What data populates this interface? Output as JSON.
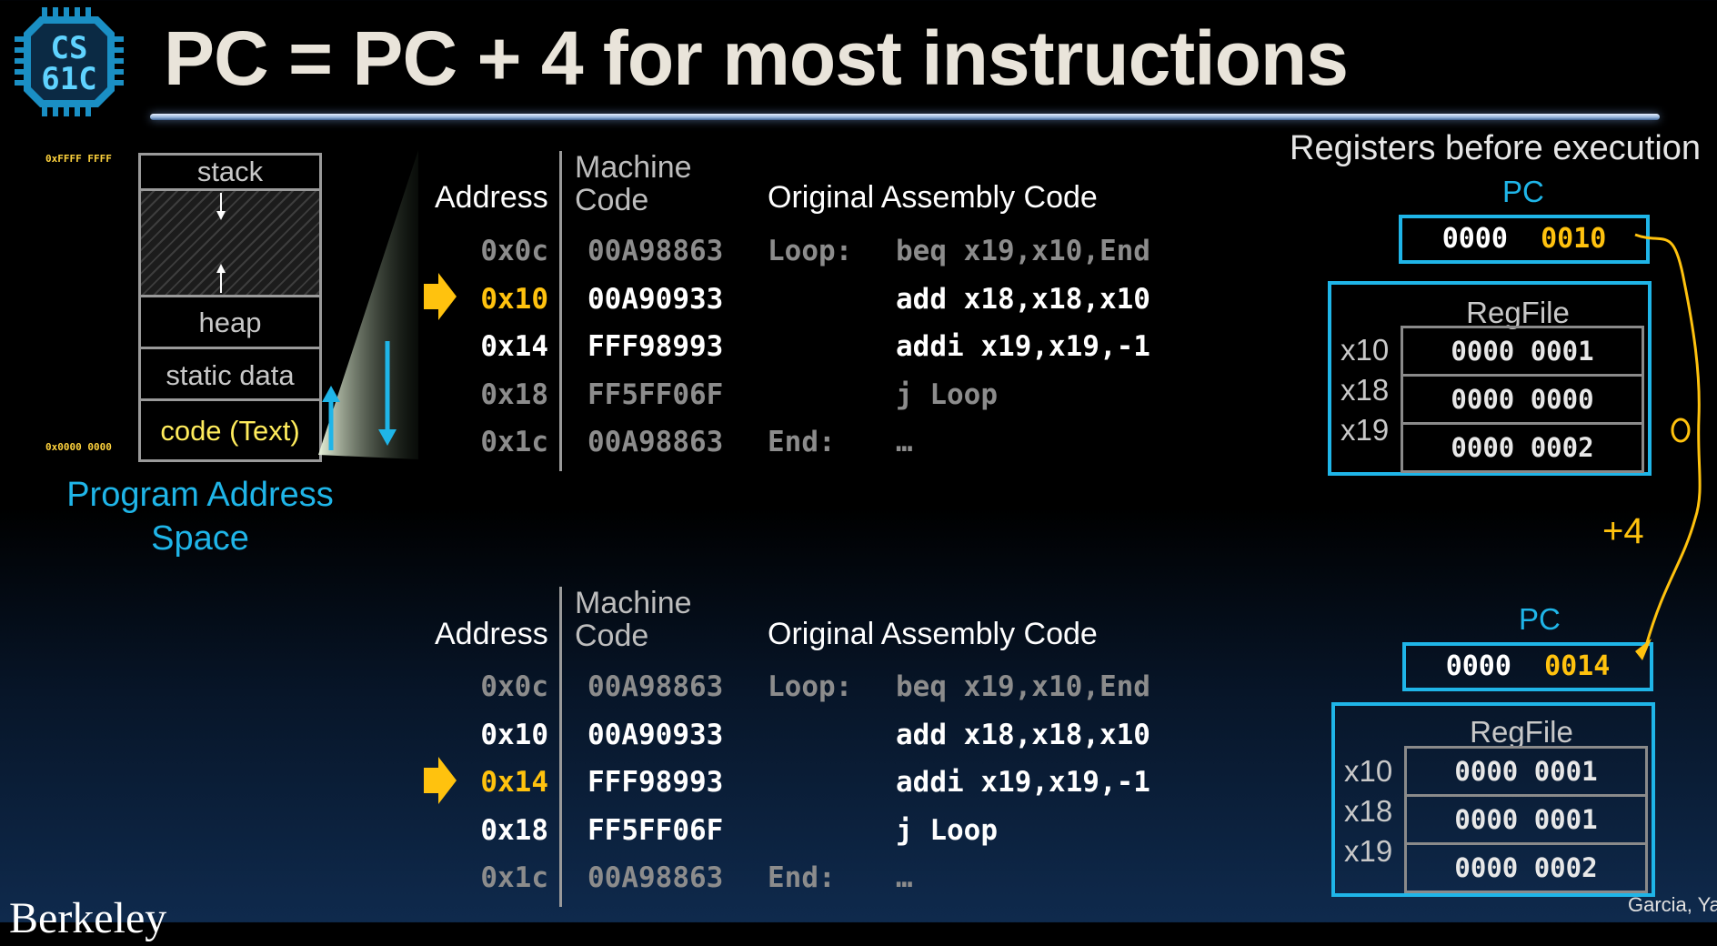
{
  "title": "PC = PC + 4 for most instructions",
  "logo": {
    "line1": "CS",
    "line2": "61C"
  },
  "memory": {
    "top_address": "0xFFFF FFFF",
    "bottom_address": "0x0000 0000",
    "segments": [
      "stack",
      "heap",
      "static data",
      "code (Text)"
    ],
    "caption": "Program Address Space"
  },
  "headers": {
    "address": "Address",
    "machine_code": "Machine Code",
    "assembly": "Original Assembly Code"
  },
  "before": {
    "rows": [
      {
        "addr": "0x0c",
        "mc": "00A98863",
        "label": "Loop:",
        "instr": "beq x19,x10,End"
      },
      {
        "addr": "0x10",
        "mc": "00A90933",
        "label": "",
        "instr": "add x18,x18,x10"
      },
      {
        "addr": "0x14",
        "mc": "FFF98993",
        "label": "",
        "instr": "addi x19,x19,-1"
      },
      {
        "addr": "0x18",
        "mc": "FF5FF06F",
        "label": "",
        "instr": "j Loop"
      },
      {
        "addr": "0x1c",
        "mc": "00A98863",
        "label": "End:",
        "instr": "…"
      }
    ],
    "current_row": 1
  },
  "after": {
    "rows": [
      {
        "addr": "0x0c",
        "mc": "00A98863",
        "label": "Loop:",
        "instr": "beq x19,x10,End"
      },
      {
        "addr": "0x10",
        "mc": "00A90933",
        "label": "",
        "instr": "add x18,x18,x10"
      },
      {
        "addr": "0x14",
        "mc": "FFF98993",
        "label": "",
        "instr": "addi x19,x19,-1"
      },
      {
        "addr": "0x18",
        "mc": "FF5FF06F",
        "label": "",
        "instr": "j Loop"
      },
      {
        "addr": "0x1c",
        "mc": "00A98863",
        "label": "End:",
        "instr": "…"
      }
    ],
    "current_row": 2
  },
  "registers_title": "Registers before execution",
  "pc_label": "PC",
  "pc_before": {
    "hi": "0000",
    "lo": "0010"
  },
  "pc_after": {
    "hi": "0000",
    "lo": "0014"
  },
  "regfile_label": "RegFile",
  "reg_names": [
    "x10",
    "x18",
    "x19"
  ],
  "regs_before": [
    "0000 0001",
    "0000 0000",
    "0000 0002"
  ],
  "regs_after": [
    "0000 0001",
    "0000 0001",
    "0000 0002"
  ],
  "increment": "+4",
  "footer": {
    "left": "Berkeley",
    "right": "Garcia, Ya"
  },
  "colors": {
    "accent_blue": "#1fb5e8",
    "highlight_yellow": "#ffc20e",
    "background": "#000000"
  }
}
